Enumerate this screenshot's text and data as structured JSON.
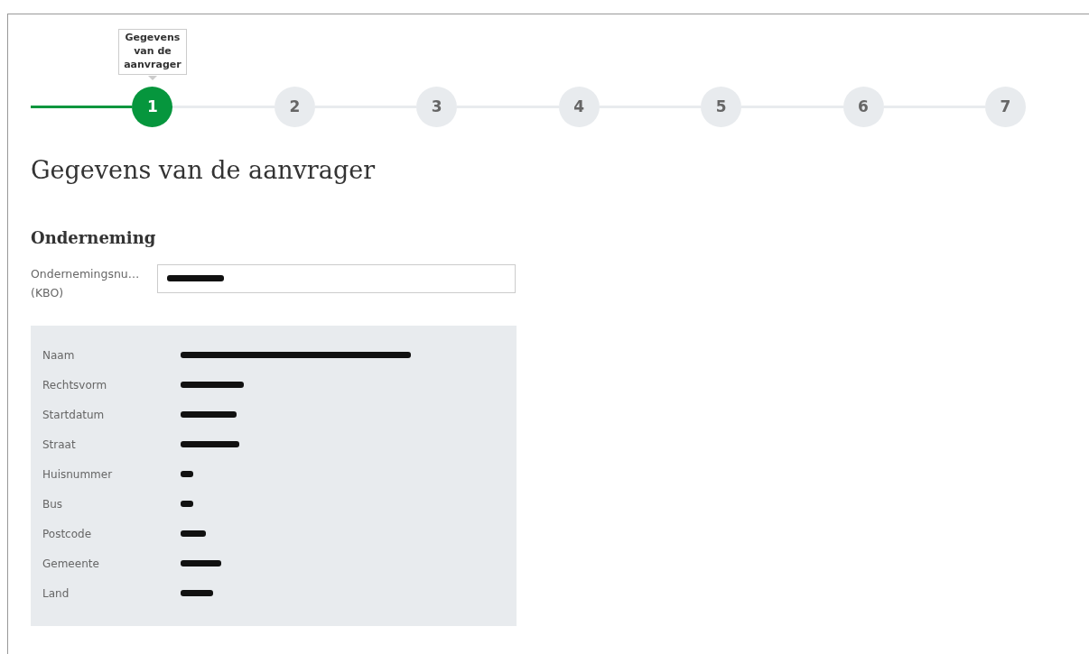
{
  "stepper": {
    "tooltip": "Gegevens van de aanvrager",
    "steps": [
      {
        "label": "1",
        "selected": true
      },
      {
        "label": "2",
        "selected": false
      },
      {
        "label": "3",
        "selected": false
      },
      {
        "label": "4",
        "selected": false
      },
      {
        "label": "5",
        "selected": false
      },
      {
        "label": "6",
        "selected": false
      },
      {
        "label": "7",
        "selected": false
      }
    ]
  },
  "title": "Gegevens van de aanvrager",
  "section": "Onderneming",
  "field": {
    "label": "Ondernemingsnu…",
    "label_suffix": "(KBO)",
    "value_redacted": true
  },
  "details": [
    {
      "label": "Naam",
      "value_redacted": true
    },
    {
      "label": "Rechtsvorm",
      "value_redacted": true
    },
    {
      "label": "Startdatum",
      "value_redacted": true
    },
    {
      "label": "Straat",
      "value_redacted": true
    },
    {
      "label": "Huisnummer",
      "value_redacted": true
    },
    {
      "label": "Bus",
      "value_redacted": true
    },
    {
      "label": "Postcode",
      "value_redacted": true
    },
    {
      "label": "Gemeente",
      "value_redacted": true
    },
    {
      "label": "Land",
      "value_redacted": true
    }
  ]
}
